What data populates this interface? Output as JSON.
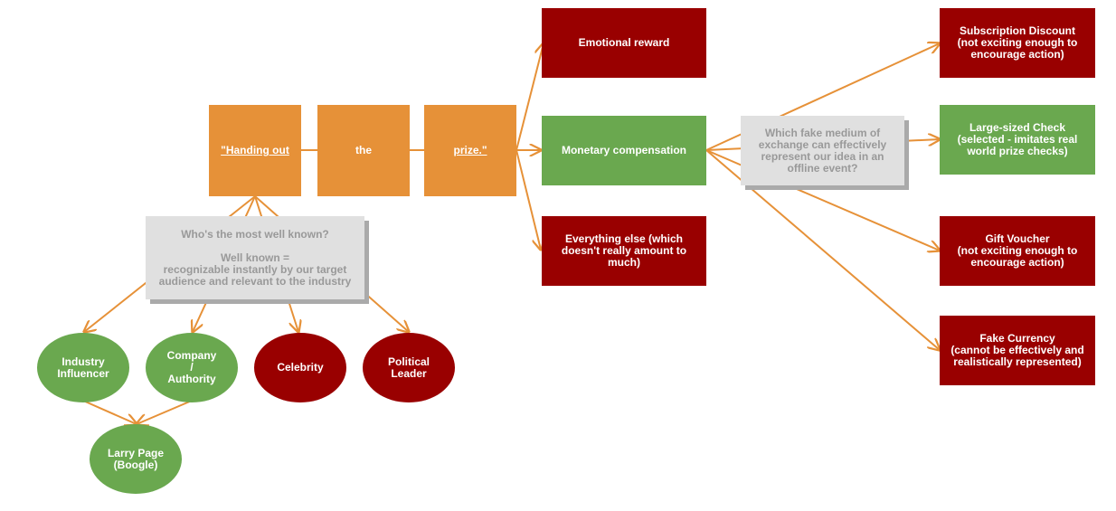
{
  "title_phrase": {
    "word1": "\"Handing out",
    "word2": "the",
    "word3": "prize.\""
  },
  "notes": {
    "well_known": "Who's the most well known?\n\nWell known =\nrecognizable instantly by our target audience and relevant to the industry",
    "fake_medium": "Which fake medium of exchange can effectively represent our idea in an offline event?"
  },
  "reward_types": [
    {
      "label": "Emotional reward",
      "status": "rejected"
    },
    {
      "label": "Monetary compensation",
      "status": "selected"
    },
    {
      "label": "Everything else (which doesn't really amount to much)",
      "status": "rejected"
    }
  ],
  "mediums": [
    {
      "label": "Subscription Discount\n(not exciting enough to encourage action)",
      "status": "rejected"
    },
    {
      "label": "Large-sized Check\n(selected - imitates real world prize checks)",
      "status": "selected"
    },
    {
      "label": "Gift Voucher\n(not exciting enough to encourage action)",
      "status": "rejected"
    },
    {
      "label": "Fake Currency\n(cannot be effectively and realistically represented)",
      "status": "rejected"
    }
  ],
  "people": [
    {
      "label": "Industry Influencer",
      "status": "selected"
    },
    {
      "label": "Company\n/\nAuthority",
      "status": "selected"
    },
    {
      "label": "Celebrity",
      "status": "rejected"
    },
    {
      "label": "Political Leader",
      "status": "rejected"
    }
  ],
  "result": {
    "label": "Larry Page\n(Boogle)",
    "status": "selected"
  },
  "colors": {
    "orange": "#e69138",
    "selected": "#6aa84f",
    "rejected": "#990000",
    "note_bg": "#e0e0e0",
    "edge": "#e69138"
  }
}
